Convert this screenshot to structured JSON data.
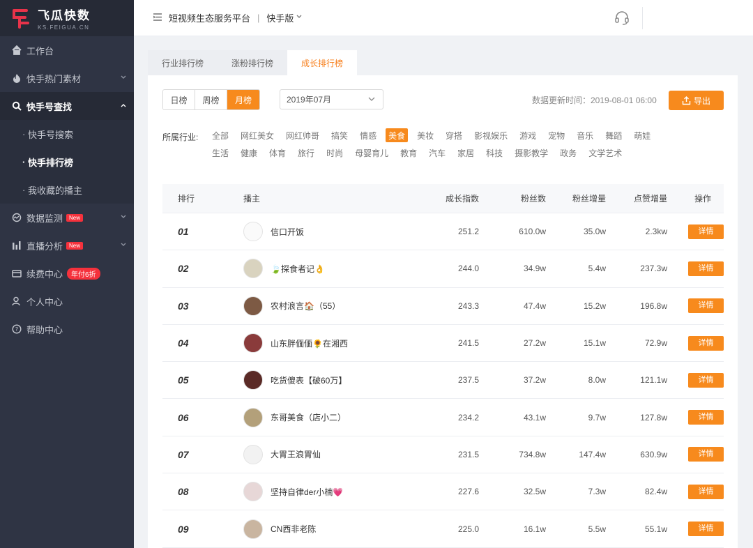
{
  "brand": {
    "name": "飞瓜快数",
    "domain": "KS.FEIGUA.CN",
    "color": "#e8334a"
  },
  "sidebar": {
    "items": [
      {
        "label": "工作台",
        "icon": "home-icon"
      },
      {
        "label": "快手热门素材",
        "icon": "flame-icon"
      },
      {
        "label": "快手号查找",
        "icon": "search-icon"
      },
      {
        "label": "数据监测",
        "icon": "monitor-icon",
        "badge": "New"
      },
      {
        "label": "直播分析",
        "icon": "bar-chart-icon",
        "badge": "New"
      },
      {
        "label": "续费中心",
        "icon": "card-icon",
        "promo": "年付6折"
      },
      {
        "label": "个人中心",
        "icon": "user-icon"
      },
      {
        "label": "帮助中心",
        "icon": "help-icon"
      }
    ],
    "subitems": [
      "快手号搜索",
      "快手排行榜",
      "我收藏的播主"
    ]
  },
  "topbar": {
    "menu_icon": "☰",
    "platform": "短视频生态服务平台",
    "separator": "|",
    "version": "快手版"
  },
  "tabs": [
    "行业排行榜",
    "涨粉排行榜",
    "成长排行榜"
  ],
  "period": [
    "日榜",
    "周榜",
    "月榜"
  ],
  "month": "2019年07月",
  "update_time": "数据更新时间：2019-08-01 06:00",
  "export_label": "导出",
  "industry": {
    "label": "所属行业:",
    "row1": [
      "全部",
      "网红美女",
      "网红帅哥",
      "搞笑",
      "情感",
      "美食",
      "美妆",
      "穿搭",
      "影视娱乐",
      "游戏",
      "宠物",
      "音乐",
      "舞蹈",
      "萌娃"
    ],
    "row2": [
      "生活",
      "健康",
      "体育",
      "旅行",
      "时尚",
      "母婴育儿",
      "教育",
      "汽车",
      "家居",
      "科技",
      "摄影教学",
      "政务",
      "文学艺术"
    ],
    "selected": "美食"
  },
  "table": {
    "headers": [
      "排行",
      "播主",
      "成长指数",
      "粉丝数",
      "粉丝增量",
      "点赞增量",
      "操作"
    ],
    "rows": [
      {
        "rank": "01",
        "name": "信口开饭",
        "growth": "251.2",
        "fans": "610.0w",
        "fans_inc": "35.0w",
        "likes_inc": "2.3kw",
        "action": "详情"
      },
      {
        "rank": "02",
        "name": "🍃探食者记👌",
        "growth": "244.0",
        "fans": "34.9w",
        "fans_inc": "5.4w",
        "likes_inc": "237.3w",
        "action": "详情"
      },
      {
        "rank": "03",
        "name": "农村浪言🏠（55）",
        "growth": "243.3",
        "fans": "47.4w",
        "fans_inc": "15.2w",
        "likes_inc": "196.8w",
        "action": "详情"
      },
      {
        "rank": "04",
        "name": "山东胖偭偭🌻在湘西",
        "growth": "241.5",
        "fans": "27.2w",
        "fans_inc": "15.1w",
        "likes_inc": "72.9w",
        "action": "详情"
      },
      {
        "rank": "05",
        "name": "吃货傻表【破60万】",
        "growth": "237.5",
        "fans": "37.2w",
        "fans_inc": "8.0w",
        "likes_inc": "121.1w",
        "action": "详情"
      },
      {
        "rank": "06",
        "name": "东哥美食（店小二）",
        "growth": "234.2",
        "fans": "43.1w",
        "fans_inc": "9.7w",
        "likes_inc": "127.8w",
        "action": "详情"
      },
      {
        "rank": "07",
        "name": "大胃王浪胃仙",
        "growth": "231.5",
        "fans": "734.8w",
        "fans_inc": "147.4w",
        "likes_inc": "630.9w",
        "action": "详情"
      },
      {
        "rank": "08",
        "name": "坚持自律der小楠💗",
        "growth": "227.6",
        "fans": "32.5w",
        "fans_inc": "7.3w",
        "likes_inc": "82.4w",
        "action": "详情"
      },
      {
        "rank": "09",
        "name": "CN西非老陈",
        "growth": "225.0",
        "fans": "16.1w",
        "fans_inc": "5.5w",
        "likes_inc": "55.1w",
        "action": "详情"
      }
    ]
  },
  "colors": {
    "accent": "#f78a1d",
    "sidebar_bg": "#2f3444",
    "badge_red": "#f5313c"
  }
}
